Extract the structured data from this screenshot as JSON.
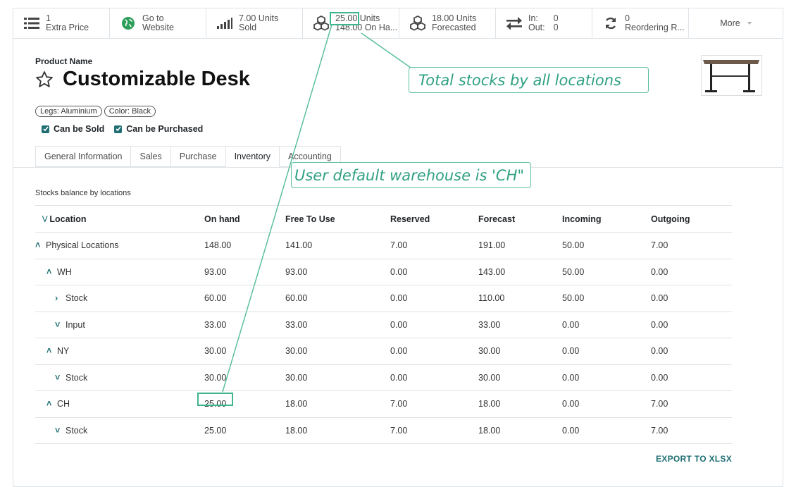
{
  "smart_buttons": [
    {
      "line1": "1",
      "line2": "Extra Price",
      "icon": "list-icon"
    },
    {
      "line1": "Go to",
      "line2": "Website",
      "icon": "globe-icon"
    },
    {
      "line1": "7.00 Units",
      "line2": "Sold",
      "icon": "signal-icon"
    },
    {
      "line1": "25.00 Units",
      "line2": "148.00 On Ha...",
      "icon": "cubes-icon"
    },
    {
      "line1": "18.00 Units",
      "line2": "Forecasted",
      "icon": "cubes-icon"
    },
    {
      "in_label": "In:",
      "in_value": "0",
      "out_label": "Out:",
      "out_value": "0",
      "icon": "exchange-icon"
    },
    {
      "line1": "0",
      "line2": "Reordering R...",
      "icon": "refresh-icon"
    },
    {
      "label": "More"
    }
  ],
  "product": {
    "name_label": "Product Name",
    "name": "Customizable Desk",
    "tags": [
      "Legs: Aluminium",
      "Color: Black"
    ],
    "can_be_sold": "Can be Sold",
    "can_be_purchased": "Can be Purchased"
  },
  "tabs": [
    "General Information",
    "Sales",
    "Purchase",
    "Inventory",
    "Accounting"
  ],
  "active_tab": "Inventory",
  "table": {
    "caption": "Stocks balance by locations",
    "headers": [
      "Location",
      "On hand",
      "Free To Use",
      "Reserved",
      "Forecast",
      "Incoming",
      "Outgoing"
    ],
    "rows": [
      {
        "toggle": "^",
        "location": "Physical Locations",
        "indent": 0,
        "values": [
          "148.00",
          "141.00",
          "7.00",
          "191.00",
          "50.00",
          "7.00"
        ]
      },
      {
        "toggle": "^",
        "location": "WH",
        "indent": 1,
        "values": [
          "93.00",
          "93.00",
          "0.00",
          "143.00",
          "50.00",
          "0.00"
        ]
      },
      {
        "toggle": ">",
        "location": "Stock",
        "indent": 2,
        "values": [
          "60.00",
          "60.00",
          "0.00",
          "110.00",
          "50.00",
          "0.00"
        ]
      },
      {
        "toggle": "v",
        "location": "Input",
        "indent": 2,
        "values": [
          "33.00",
          "33.00",
          "0.00",
          "33.00",
          "0.00",
          "0.00"
        ]
      },
      {
        "toggle": "^",
        "location": "NY",
        "indent": 1,
        "values": [
          "30.00",
          "30.00",
          "0.00",
          "30.00",
          "0.00",
          "0.00"
        ]
      },
      {
        "toggle": "v",
        "location": "Stock",
        "indent": 2,
        "values": [
          "30.00",
          "30.00",
          "0.00",
          "30.00",
          "0.00",
          "0.00"
        ]
      },
      {
        "toggle": "^",
        "location": "CH",
        "indent": 1,
        "values": [
          "25.00",
          "18.00",
          "7.00",
          "18.00",
          "0.00",
          "7.00"
        ]
      },
      {
        "toggle": "v",
        "location": "Stock",
        "indent": 2,
        "values": [
          "25.00",
          "18.00",
          "7.00",
          "18.00",
          "0.00",
          "7.00"
        ]
      }
    ],
    "export_label": "EXPORT TO XLSX"
  },
  "annotations": {
    "total_stocks": "Total stocks by all locations",
    "default_warehouse": "User default warehouse is 'CH\""
  },
  "colors": {
    "accent": "#1f6f73",
    "annotation": "#3fb58f"
  }
}
